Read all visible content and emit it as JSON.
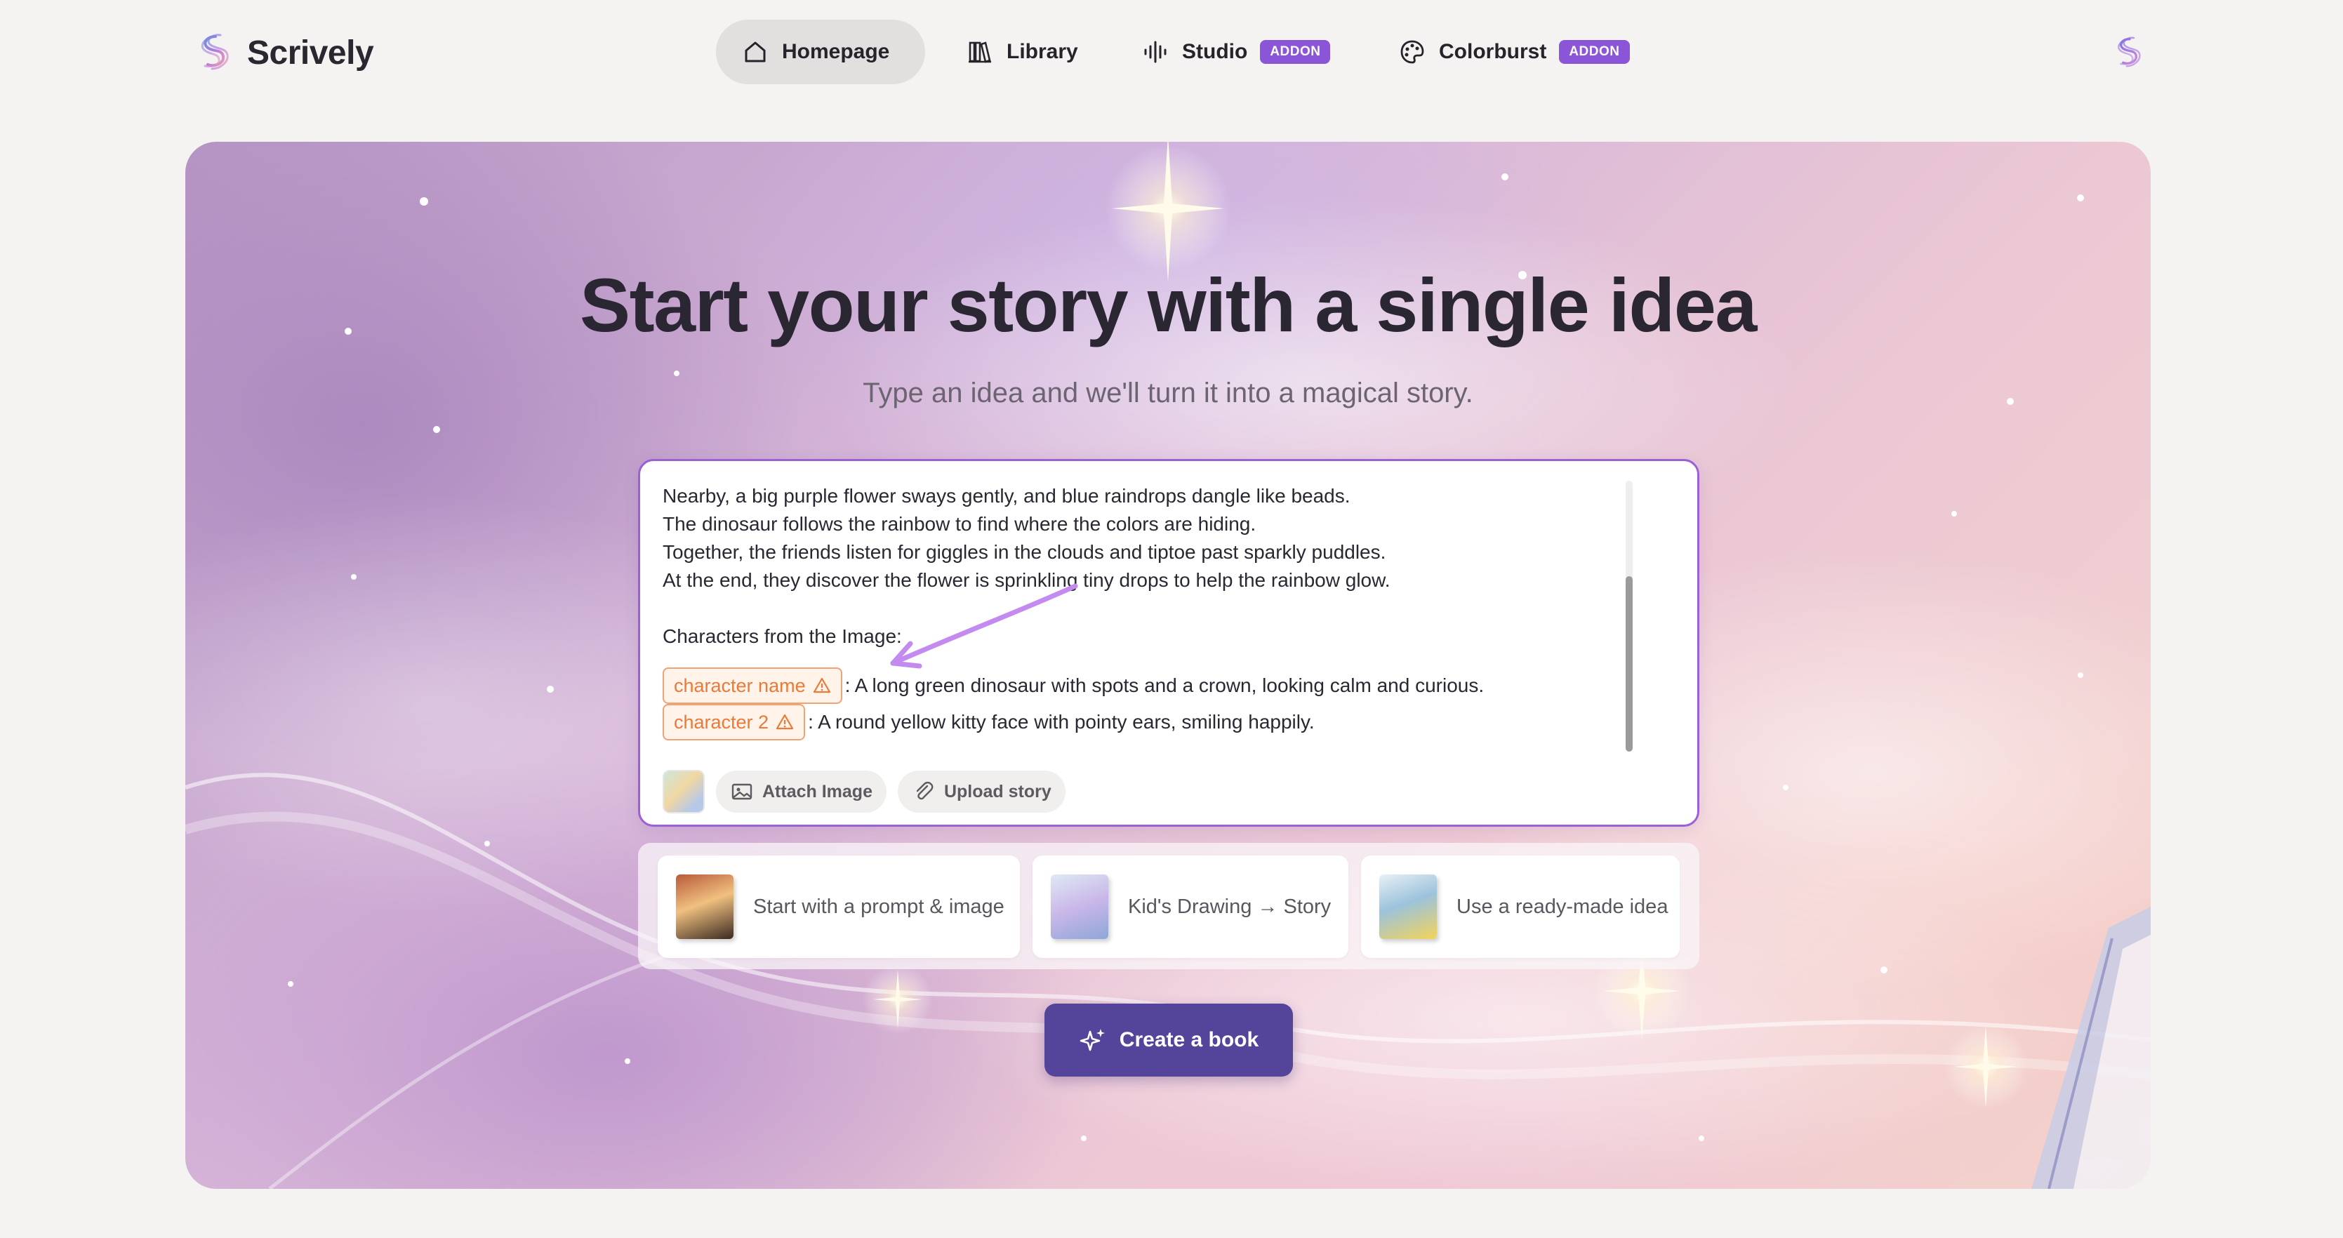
{
  "brand": {
    "name": "Scrively"
  },
  "nav": {
    "items": [
      {
        "label": "Homepage",
        "icon": "home-icon",
        "active": true
      },
      {
        "label": "Library",
        "icon": "books-icon"
      },
      {
        "label": "Studio",
        "icon": "audio-wave-icon",
        "badge": "ADDON"
      },
      {
        "label": "Colorburst",
        "icon": "palette-icon",
        "badge": "ADDON"
      }
    ]
  },
  "hero": {
    "title": "Start your story with a single idea",
    "subtitle": "Type an idea and we'll turn it into a magical story."
  },
  "editor": {
    "lines": [
      "Nearby, a big purple flower sways gently, and blue raindrops dangle like beads.",
      "The dinosaur follows the rainbow to find where the colors are hiding.",
      "Together, the friends listen for giggles in the clouds and tiptoe past sparkly puddles.",
      "At the end, they discover the flower is sprinkling tiny drops to help the rainbow glow."
    ],
    "characters_heading": "Characters from the Image:",
    "characters": [
      {
        "tag": "character name",
        "description": ": A long green dinosaur with spots and a crown, looking calm and curious."
      },
      {
        "tag": "character 2",
        "description": ": A round yellow kitty face with pointy ears, smiling happily."
      }
    ],
    "tools": {
      "attach_label": "Attach Image",
      "upload_label": "Upload story"
    }
  },
  "options": [
    {
      "label": "Start with a prompt & image"
    },
    {
      "label": "Kid's Drawing → Story"
    },
    {
      "label": "Use a ready-made idea"
    }
  ],
  "cta": {
    "label": "Create a book"
  },
  "colors": {
    "accent": "#54449a",
    "badge": "#8a55d6",
    "editor_border": "#9b5fd8",
    "tag": "#ea7a38"
  }
}
